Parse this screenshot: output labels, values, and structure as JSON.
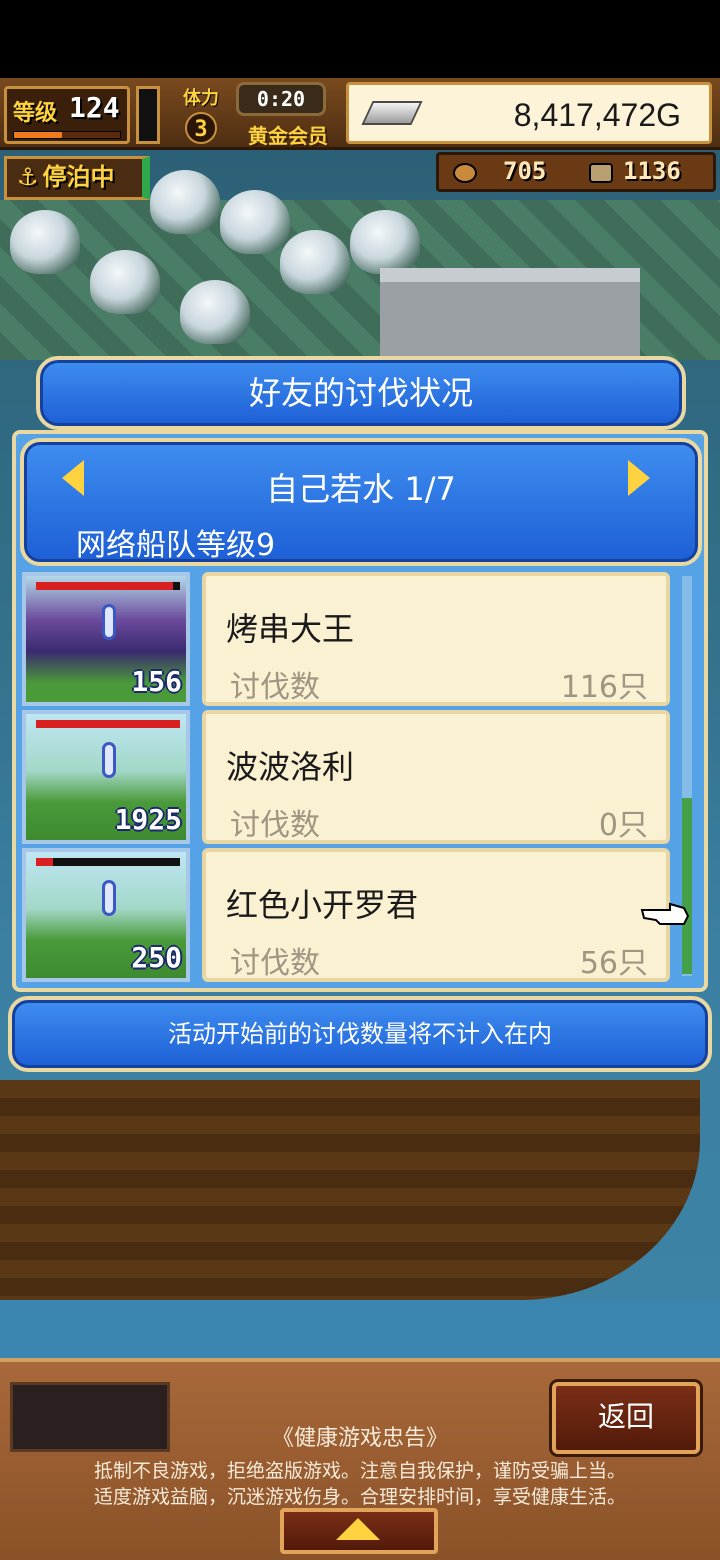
{
  "hud": {
    "level_label": "等级",
    "level_value": "124",
    "level_progress": 0.45,
    "stamina_label": "体力",
    "stamina_value": "3",
    "timer": "0:20",
    "membership": "黄金会员",
    "gold": "8,417,472G",
    "status_badge": "停泊中",
    "resource_1": "705",
    "resource_2": "1136"
  },
  "modal": {
    "title": "好友的讨伐状况",
    "friend_name": "自己若水 1/7",
    "fleet_level": "网络船队等级9",
    "prev_icon": "arrow-left-icon",
    "next_icon": "arrow-right-icon",
    "entries": [
      {
        "name": "烤串大王",
        "label": "讨伐数",
        "value": "116只",
        "badge": "156",
        "hp": 0.95
      },
      {
        "name": "波波洛利",
        "label": "讨伐数",
        "value": "0只",
        "badge": "1925",
        "hp": 1.0
      },
      {
        "name": "红色小开罗君",
        "label": "讨伐数",
        "value": "56只",
        "badge": "250",
        "hp": 0.12
      }
    ],
    "notice": "活动开始前的讨伐数量将不计入在内"
  },
  "bottom": {
    "back_label": "返回",
    "health_title": "《健康游戏忠告》",
    "health_line1": "抵制不良游戏，拒绝盗版游戏。注意自我保护，谨防受骗上当。",
    "health_line2": "适度游戏益脑，沉迷游戏伤身。合理安排时间，享受健康生活。"
  },
  "colors": {
    "panel_blue": "#1d5fd6",
    "card_bg": "#faf0d2",
    "gold_text": "#ffd23f"
  }
}
